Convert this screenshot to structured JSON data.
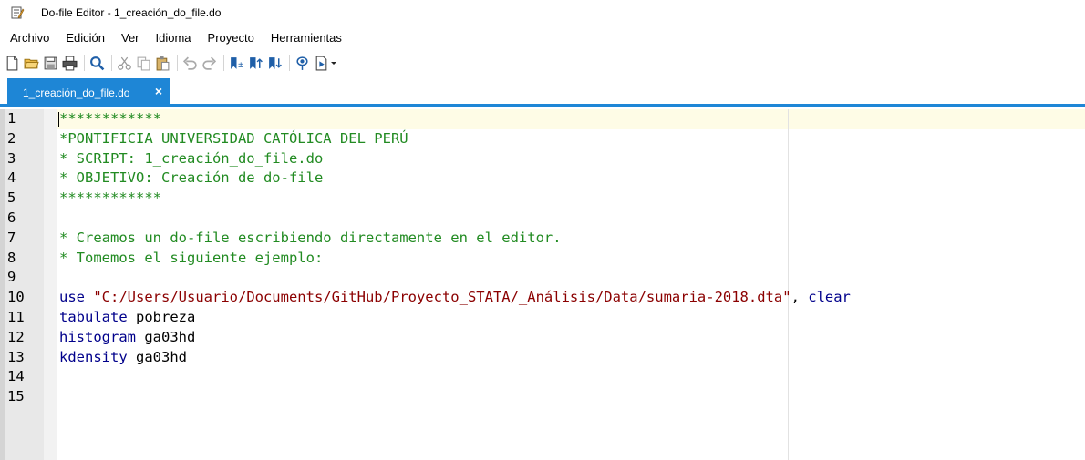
{
  "window": {
    "title": "Do-file Editor - 1_creación_do_file.do"
  },
  "menu": [
    "Archivo",
    "Edición",
    "Ver",
    "Idioma",
    "Proyecto",
    "Herramientas"
  ],
  "toolbar": {
    "icons": [
      "new-file-icon",
      "open-folder-icon",
      "save-icon",
      "print-icon",
      "find-icon",
      "cut-icon",
      "copy-icon",
      "paste-icon",
      "undo-icon",
      "redo-icon",
      "toggle-bookmark-icon",
      "previous-bookmark-icon",
      "next-bookmark-icon",
      "show-icon",
      "execute-icon"
    ]
  },
  "tab": {
    "label": "1_creación_do_file.do",
    "close": "×"
  },
  "colors": {
    "tab_active": "#1e86d6",
    "comment": "#228b22",
    "keyword": "#00008b",
    "string": "#8b0000",
    "current_line": "#fefce6"
  },
  "editor": {
    "lines": [
      {
        "n": "1",
        "parts": [
          {
            "t": "************",
            "c": "comment"
          }
        ]
      },
      {
        "n": "2",
        "parts": [
          {
            "t": "*PONTIFICIA UNIVERSIDAD CATÓLICA DEL PERÚ",
            "c": "comment"
          }
        ]
      },
      {
        "n": "3",
        "parts": [
          {
            "t": "* SCRIPT: 1_creación_do_file.do",
            "c": "comment"
          }
        ]
      },
      {
        "n": "4",
        "parts": [
          {
            "t": "* OBJETIVO: Creación de do-file",
            "c": "comment"
          }
        ]
      },
      {
        "n": "5",
        "parts": [
          {
            "t": "************",
            "c": "comment"
          }
        ]
      },
      {
        "n": "6",
        "parts": []
      },
      {
        "n": "7",
        "parts": [
          {
            "t": "* Creamos un do-file escribiendo directamente en el editor.",
            "c": "comment"
          }
        ]
      },
      {
        "n": "8",
        "parts": [
          {
            "t": "* Tomemos el siguiente ejemplo:",
            "c": "comment"
          }
        ]
      },
      {
        "n": "9",
        "parts": []
      },
      {
        "n": "10",
        "parts": [
          {
            "t": "use",
            "c": "kw"
          },
          {
            "t": " ",
            "c": "plain"
          },
          {
            "t": "\"C:/Users/Usuario/Documents/GitHub/Proyecto_STATA/_Análisis/Data/sumaria-2018.dta\"",
            "c": "str"
          },
          {
            "t": ", ",
            "c": "plain"
          },
          {
            "t": "clear",
            "c": "kw"
          }
        ]
      },
      {
        "n": "11",
        "parts": [
          {
            "t": "tabulate",
            "c": "kw"
          },
          {
            "t": " pobreza",
            "c": "plain"
          }
        ]
      },
      {
        "n": "12",
        "parts": [
          {
            "t": "histogram",
            "c": "kw"
          },
          {
            "t": " ga03hd",
            "c": "plain"
          }
        ]
      },
      {
        "n": "13",
        "parts": [
          {
            "t": "kdensity",
            "c": "kw"
          },
          {
            "t": " ga03hd",
            "c": "plain"
          }
        ]
      },
      {
        "n": "14",
        "parts": []
      },
      {
        "n": "15",
        "parts": []
      }
    ]
  }
}
